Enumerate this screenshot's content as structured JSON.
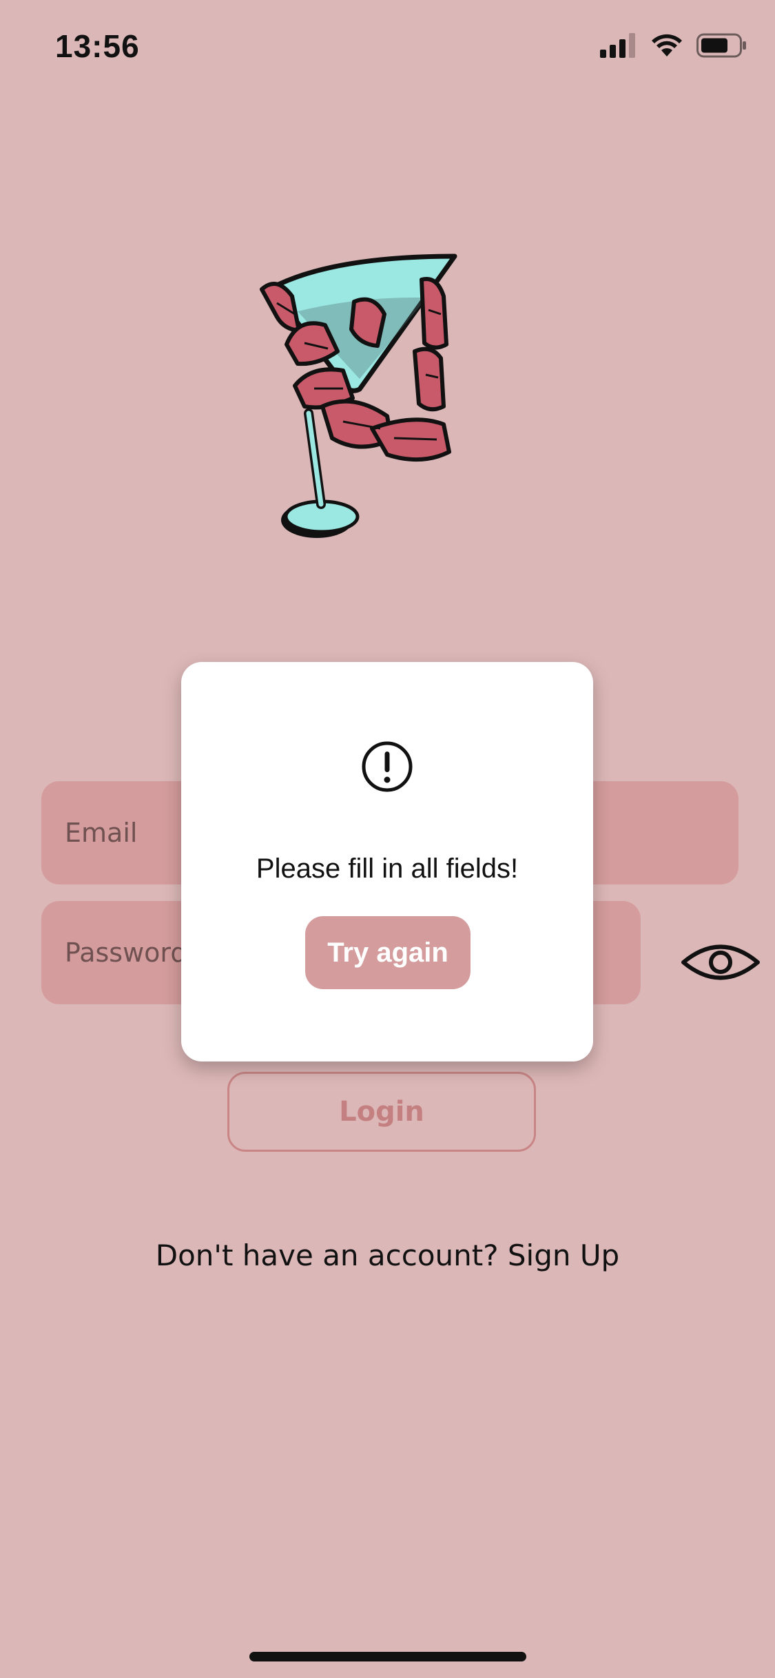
{
  "status_bar": {
    "time": "13:56",
    "icons": [
      "cellular-signal-icon",
      "wifi-icon",
      "battery-icon"
    ]
  },
  "logo": {
    "icon": "skeleton-hand-martini-logo",
    "colors": {
      "glass": "#9be8e3",
      "bones": "#c85a6a",
      "outline": "#111111"
    }
  },
  "form": {
    "email": {
      "placeholder": "Email",
      "value": ""
    },
    "password": {
      "placeholder": "Password",
      "value": ""
    },
    "show_password_icon": "eye-icon",
    "login_label": "Login",
    "signup_text": "Don't have an account? Sign Up"
  },
  "alert": {
    "icon": "exclamation-circle-icon",
    "message": "Please fill in all fields!",
    "button_label": "Try again"
  },
  "colors": {
    "background": "#dcb7b7",
    "field_fill": "#d49c9c",
    "accent": "#c47f80",
    "modal_bg": "#ffffff"
  }
}
